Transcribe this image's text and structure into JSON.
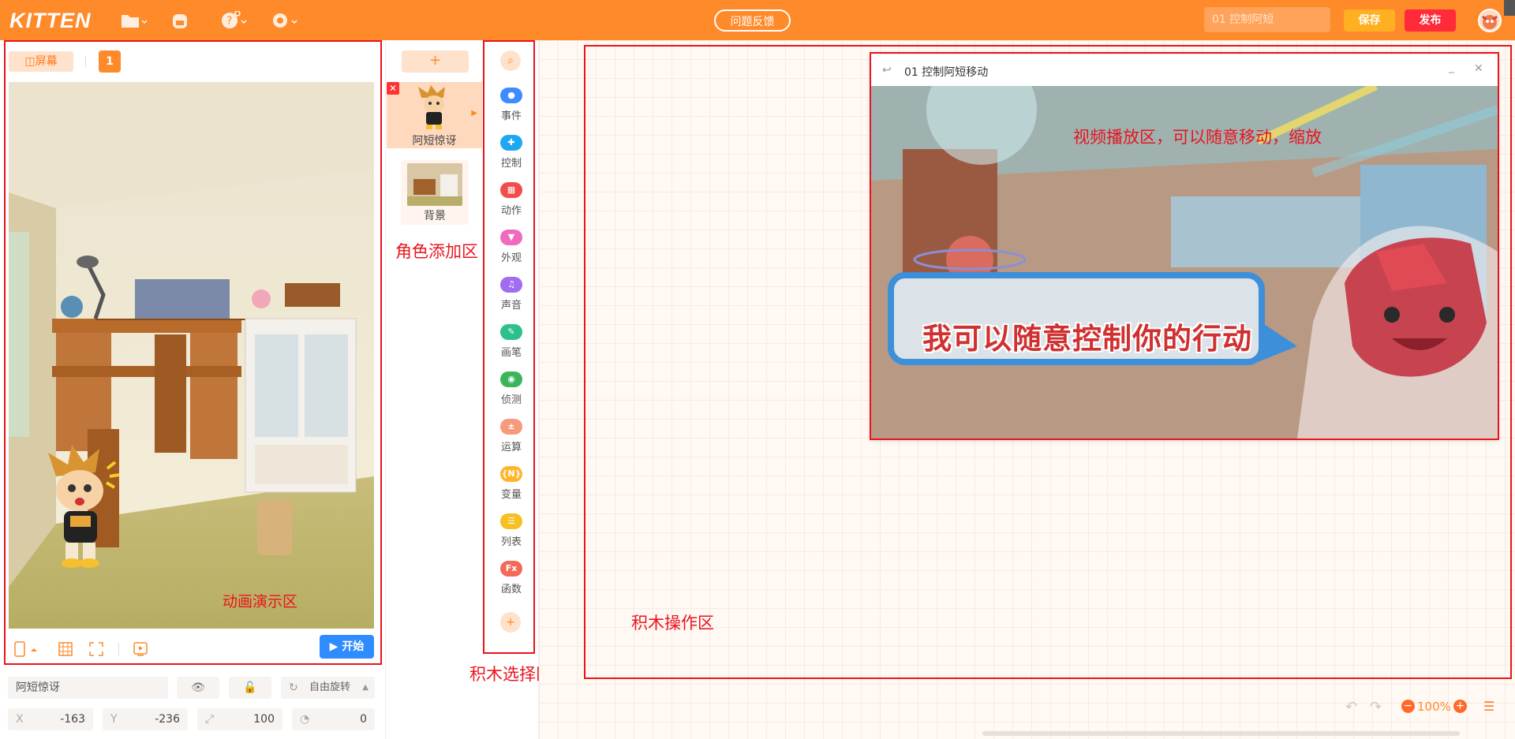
{
  "app": {
    "logo": "KITTEN"
  },
  "topbar": {
    "feedback": "问题反馈",
    "project_title": "01 控制阿短",
    "save": "保存",
    "publish": "发布"
  },
  "stage": {
    "screen_btn": "屏幕",
    "scene_number": "1",
    "start_btn": "开始",
    "props": {
      "name": "阿短惊讶",
      "rotation": "自由旋转",
      "x_label": "X",
      "x_value": "-163",
      "y_label": "Y",
      "y_value": "-236",
      "size_value": "100",
      "direction_value": "0"
    }
  },
  "sprites": {
    "add": "+",
    "items": [
      {
        "label": "阿短惊讶"
      },
      {
        "label": "背景"
      }
    ]
  },
  "categories": [
    {
      "label": "事件",
      "color": "#3d8bff",
      "glyph": "●"
    },
    {
      "label": "控制",
      "color": "#1ea8f0",
      "glyph": "✚"
    },
    {
      "label": "动作",
      "color": "#f24c4c",
      "glyph": "▦"
    },
    {
      "label": "外观",
      "color": "#f06ac0",
      "glyph": "▼"
    },
    {
      "label": "声音",
      "color": "#a06cf0",
      "glyph": "♫"
    },
    {
      "label": "画笔",
      "color": "#2cc18a",
      "glyph": "✎"
    },
    {
      "label": "侦测",
      "color": "#3bb55a",
      "glyph": "◉"
    },
    {
      "label": "运算",
      "color": "#f59a7a",
      "glyph": "±"
    },
    {
      "label": "变量",
      "color": "#ffb52a",
      "glyph": "{N}"
    },
    {
      "label": "列表",
      "color": "#f5c020",
      "glyph": "☰"
    },
    {
      "label": "函数",
      "color": "#f26a5a",
      "glyph": "Fx"
    }
  ],
  "video": {
    "title": "01 控制阿短移动",
    "caption": "我可以随意控制你的行动"
  },
  "annotations": {
    "stage_area": "动画演示区",
    "sprite_area": "角色添加区",
    "block_select": "积木选择区",
    "block_ops": "积木操作区",
    "video_area": "视频播放区，可以随意移动，缩放"
  },
  "workspace": {
    "zoom": "100%"
  },
  "colors": {
    "brand": "#ff8a2a",
    "annotation": "#e8141d",
    "start": "#2f8cff",
    "save": "#ffb020",
    "publish": "#ff2a3a"
  }
}
